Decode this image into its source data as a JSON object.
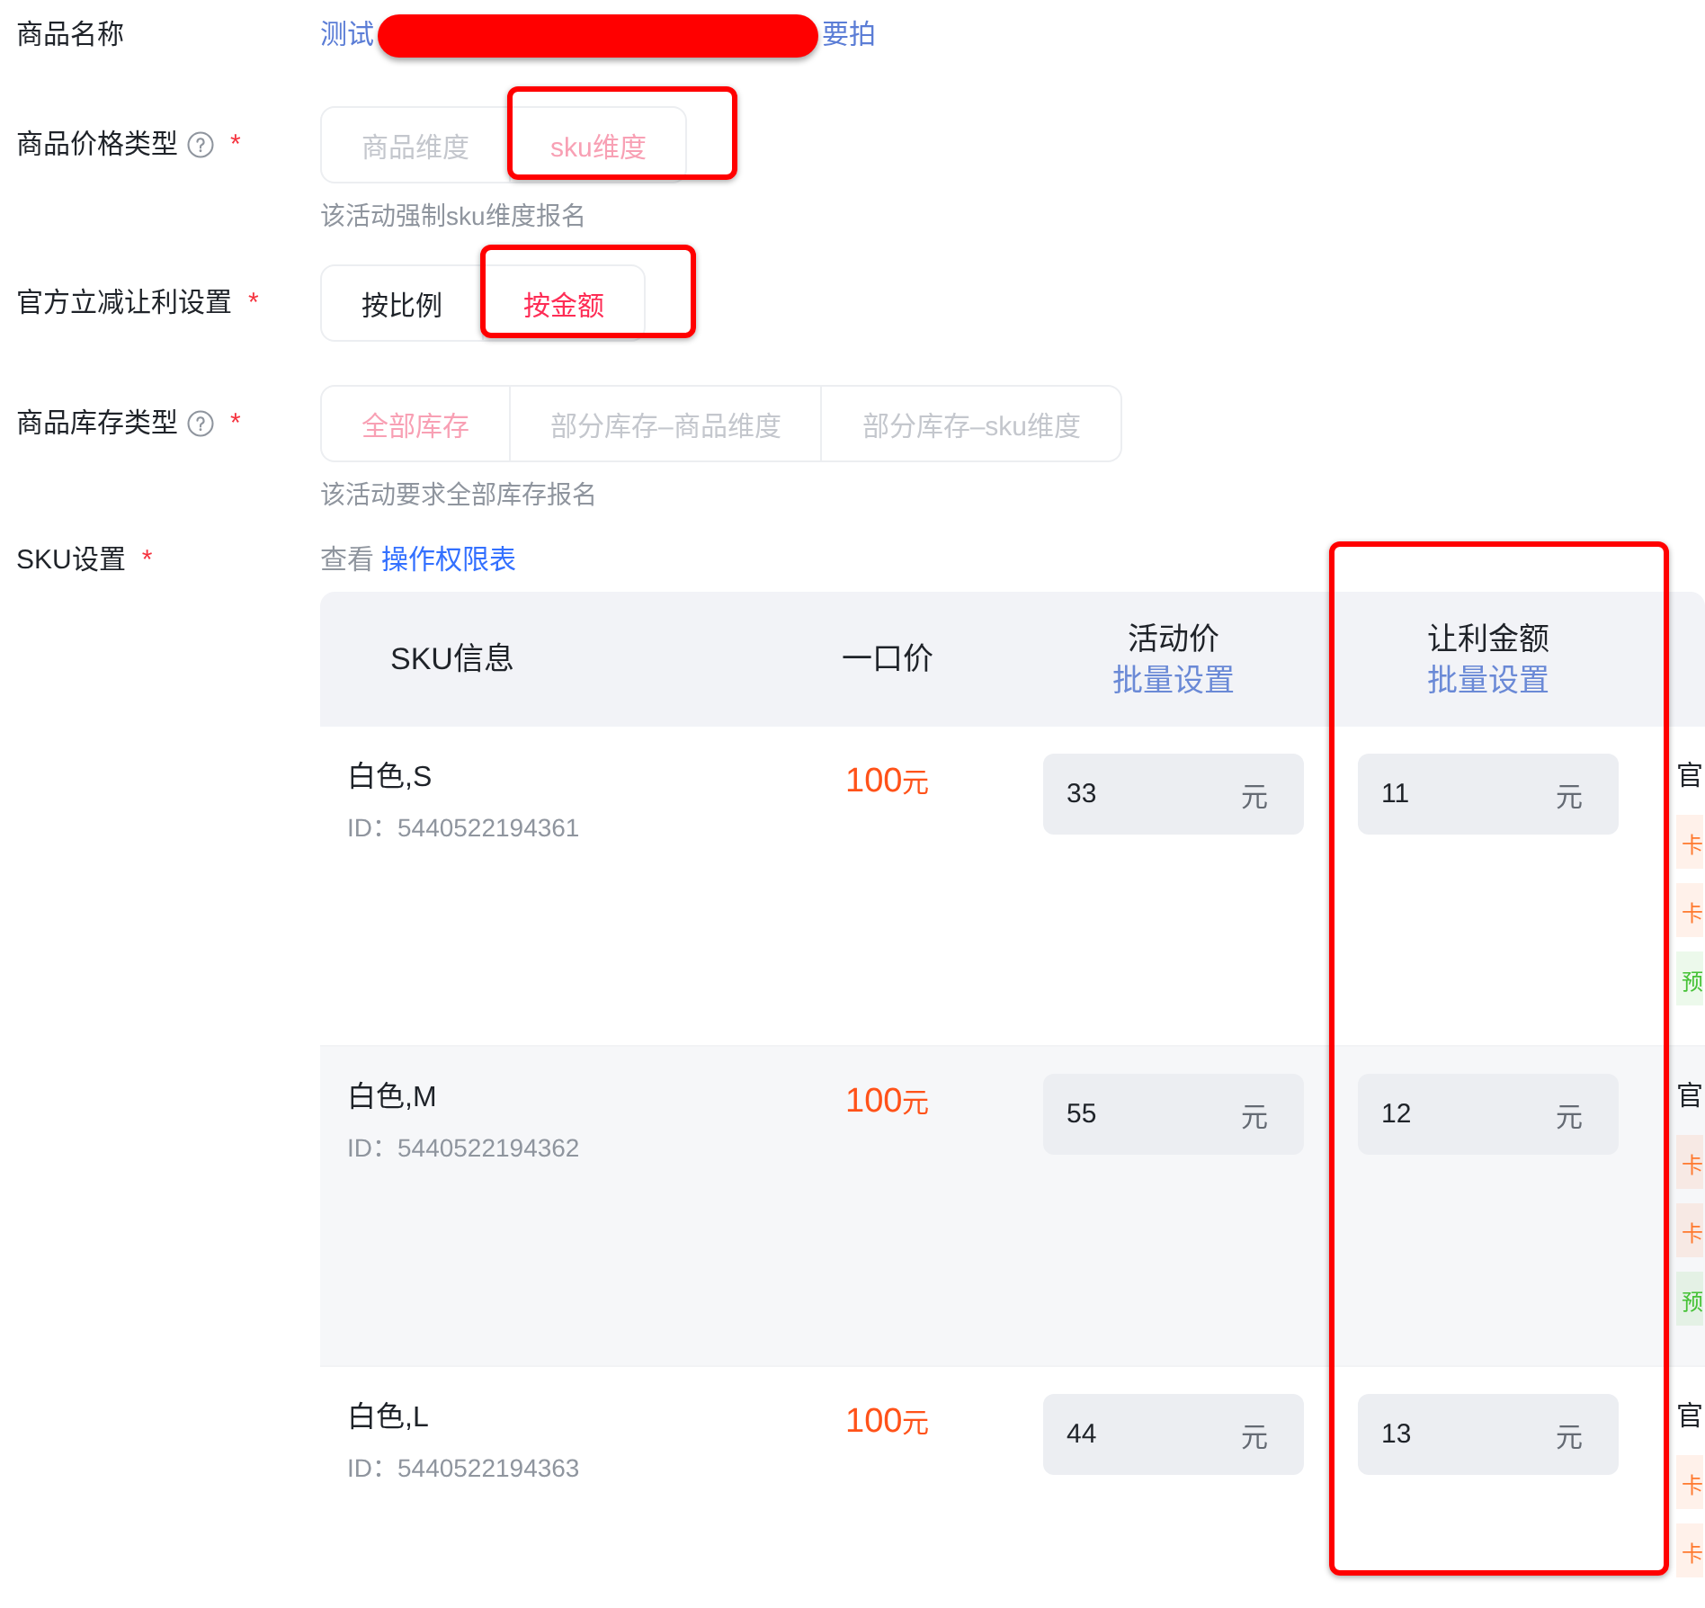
{
  "fields": [
    {
      "kind": "product_name",
      "label": "商品名称",
      "value_start": "测试",
      "redacted": true,
      "value_end": "要拍"
    },
    {
      "kind": "segmented",
      "label": "商品价格类型",
      "help": true,
      "required_mark": "*",
      "disabled": true,
      "options": [
        {
          "label": "商品维度",
          "selected": false,
          "highlighted": false
        },
        {
          "label": "sku维度",
          "selected": true,
          "highlighted": true
        }
      ],
      "hint": "该活动强制sku维度报名"
    },
    {
      "kind": "segmented",
      "label": "官方立减让利设置",
      "required_mark": "*",
      "disabled": false,
      "options": [
        {
          "label": "按比例",
          "selected": false,
          "highlighted": false
        },
        {
          "label": "按金额",
          "selected": true,
          "highlighted": true
        }
      ]
    },
    {
      "kind": "segmented",
      "label": "商品库存类型",
      "help": true,
      "required_mark": "*",
      "disabled": true,
      "options": [
        {
          "label": "全部库存",
          "selected": true,
          "highlighted": false
        },
        {
          "label": "部分库存–商品维度",
          "selected": false,
          "highlighted": false
        },
        {
          "label": "部分库存–sku维度",
          "selected": false,
          "highlighted": false
        }
      ],
      "hint": "该活动要求全部库存报名"
    },
    {
      "kind": "sku_table",
      "label": "SKU设置",
      "required_mark": "*",
      "note": "查看",
      "link": "操作权限表",
      "table": {
        "columns": [
          {
            "title": "SKU信息"
          },
          {
            "title": "一口价"
          },
          {
            "title": "活动价",
            "action": "批量设置"
          },
          {
            "title": "让利金额",
            "action": "批量设置",
            "highlighted": true
          }
        ],
        "rows": [
          {
            "name": "白色,S",
            "id": "ID：5440522194361",
            "price": "100",
            "price_unit": "元",
            "activity_price": "33",
            "activity_unit": "元",
            "discount": "11",
            "discount_unit": "元",
            "column_5": {
              "text": "官",
              "tags": [
                {
                  "text": "卡",
                  "color": "#ff7a2f"
                },
                {
                  "text": "卡",
                  "color": "#ff7a2f"
                },
                {
                  "text": "预",
                  "color": "#45c236"
                }
              ]
            }
          },
          {
            "name": "白色,M",
            "id": "ID：5440522194362",
            "price": "100",
            "price_unit": "元",
            "activity_price": "55",
            "activity_unit": "元",
            "discount": "12",
            "discount_unit": "元",
            "column_5": {
              "text": "官",
              "tags": [
                {
                  "text": "卡",
                  "color": "#ff7a2f"
                },
                {
                  "text": "卡",
                  "color": "#ff7a2f"
                },
                {
                  "text": "预",
                  "color": "#45c236"
                }
              ]
            }
          },
          {
            "name": "白色,L",
            "id": "ID：5440522194363",
            "price": "100",
            "price_unit": "元",
            "activity_price": "44",
            "activity_unit": "元",
            "discount": "13",
            "discount_unit": "元",
            "column_5": {
              "text": "官",
              "tags": [
                {
                  "text": "卡",
                  "color": "#ff7a2f"
                },
                {
                  "text": "卡",
                  "color": "#ff7a2f"
                }
              ]
            }
          }
        ]
      }
    }
  ]
}
